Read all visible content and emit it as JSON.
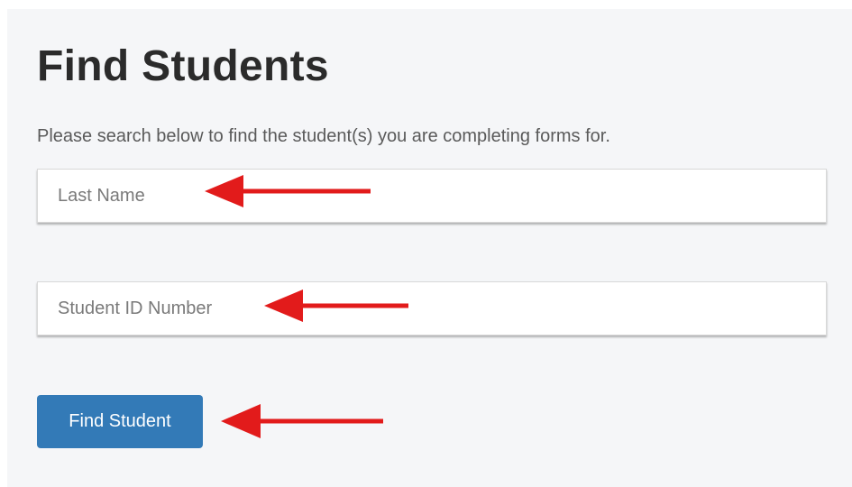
{
  "page": {
    "title": "Find Students",
    "subtitle": "Please search below to find the student(s) you are completing forms for."
  },
  "form": {
    "last_name": {
      "value": "",
      "placeholder": "Last Name"
    },
    "student_id": {
      "value": "",
      "placeholder": "Student ID Number"
    },
    "submit_label": "Find Student"
  },
  "annotations": {
    "arrow_icon": "left-arrow-icon",
    "arrow_color": "#e21b1b"
  },
  "colors": {
    "panel_background": "#f5f6f8",
    "button_background": "#337ab7",
    "title_text": "#2b2b2b"
  }
}
